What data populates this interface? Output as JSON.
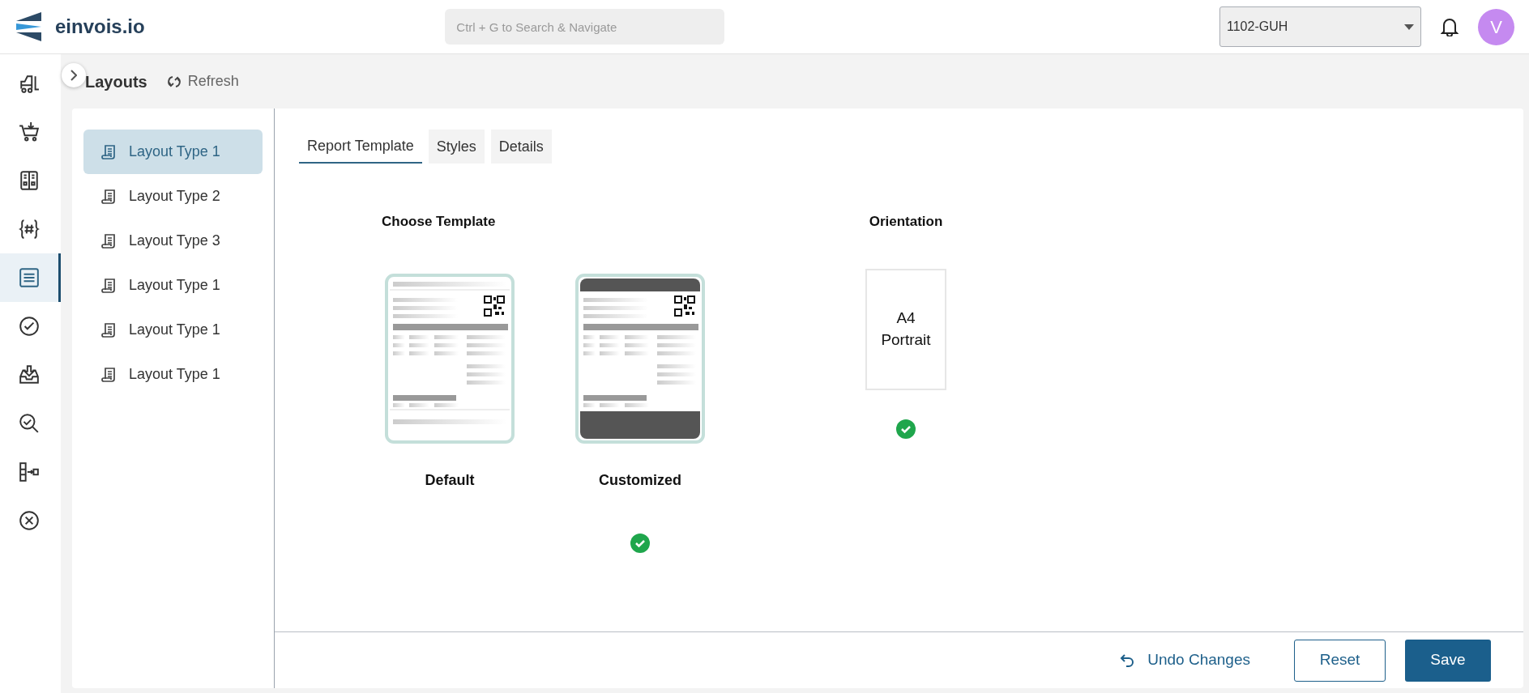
{
  "header": {
    "brand": "einvois.io",
    "search": {
      "placeholder": "Ctrl + G to Search & Navigate"
    },
    "company_select": {
      "value": "1102-GUH"
    },
    "avatar": "V"
  },
  "sidebar": {
    "items": [
      {
        "kind": "forklift",
        "selected": false
      },
      {
        "kind": "cart",
        "selected": false
      },
      {
        "kind": "binder",
        "selected": false
      },
      {
        "kind": "hash",
        "selected": false
      },
      {
        "kind": "list",
        "selected": true
      },
      {
        "kind": "check",
        "selected": false
      },
      {
        "kind": "inbox",
        "selected": false
      },
      {
        "kind": "search-check",
        "selected": false
      },
      {
        "kind": "flow",
        "selected": false
      },
      {
        "kind": "cancel",
        "selected": false
      }
    ]
  },
  "page": {
    "title": "Layouts",
    "refresh": "Refresh"
  },
  "layouts": [
    {
      "label": "Layout Type 1",
      "selected": true
    },
    {
      "label": "Layout Type 2",
      "selected": false
    },
    {
      "label": "Layout Type 3",
      "selected": false
    },
    {
      "label": "Layout Type 1",
      "selected": false
    },
    {
      "label": "Layout Type 1",
      "selected": false
    },
    {
      "label": "Layout Type 1",
      "selected": false
    }
  ],
  "tabs": [
    {
      "label": "Report Template",
      "selected": true
    },
    {
      "label": "Styles",
      "selected": false
    },
    {
      "label": "Details",
      "selected": false
    }
  ],
  "template_section": {
    "heading": "Choose Template",
    "templates": [
      {
        "name": "Default",
        "kind": "plain",
        "selected": false
      },
      {
        "name": "Customized",
        "kind": "banded",
        "selected": true
      }
    ]
  },
  "orientation_section": {
    "heading": "Orientation",
    "options": [
      {
        "label": "A4 Portrait",
        "selected": true
      }
    ]
  },
  "footer": {
    "undo": "Undo Changes",
    "reset": "Reset",
    "save": "Save"
  }
}
